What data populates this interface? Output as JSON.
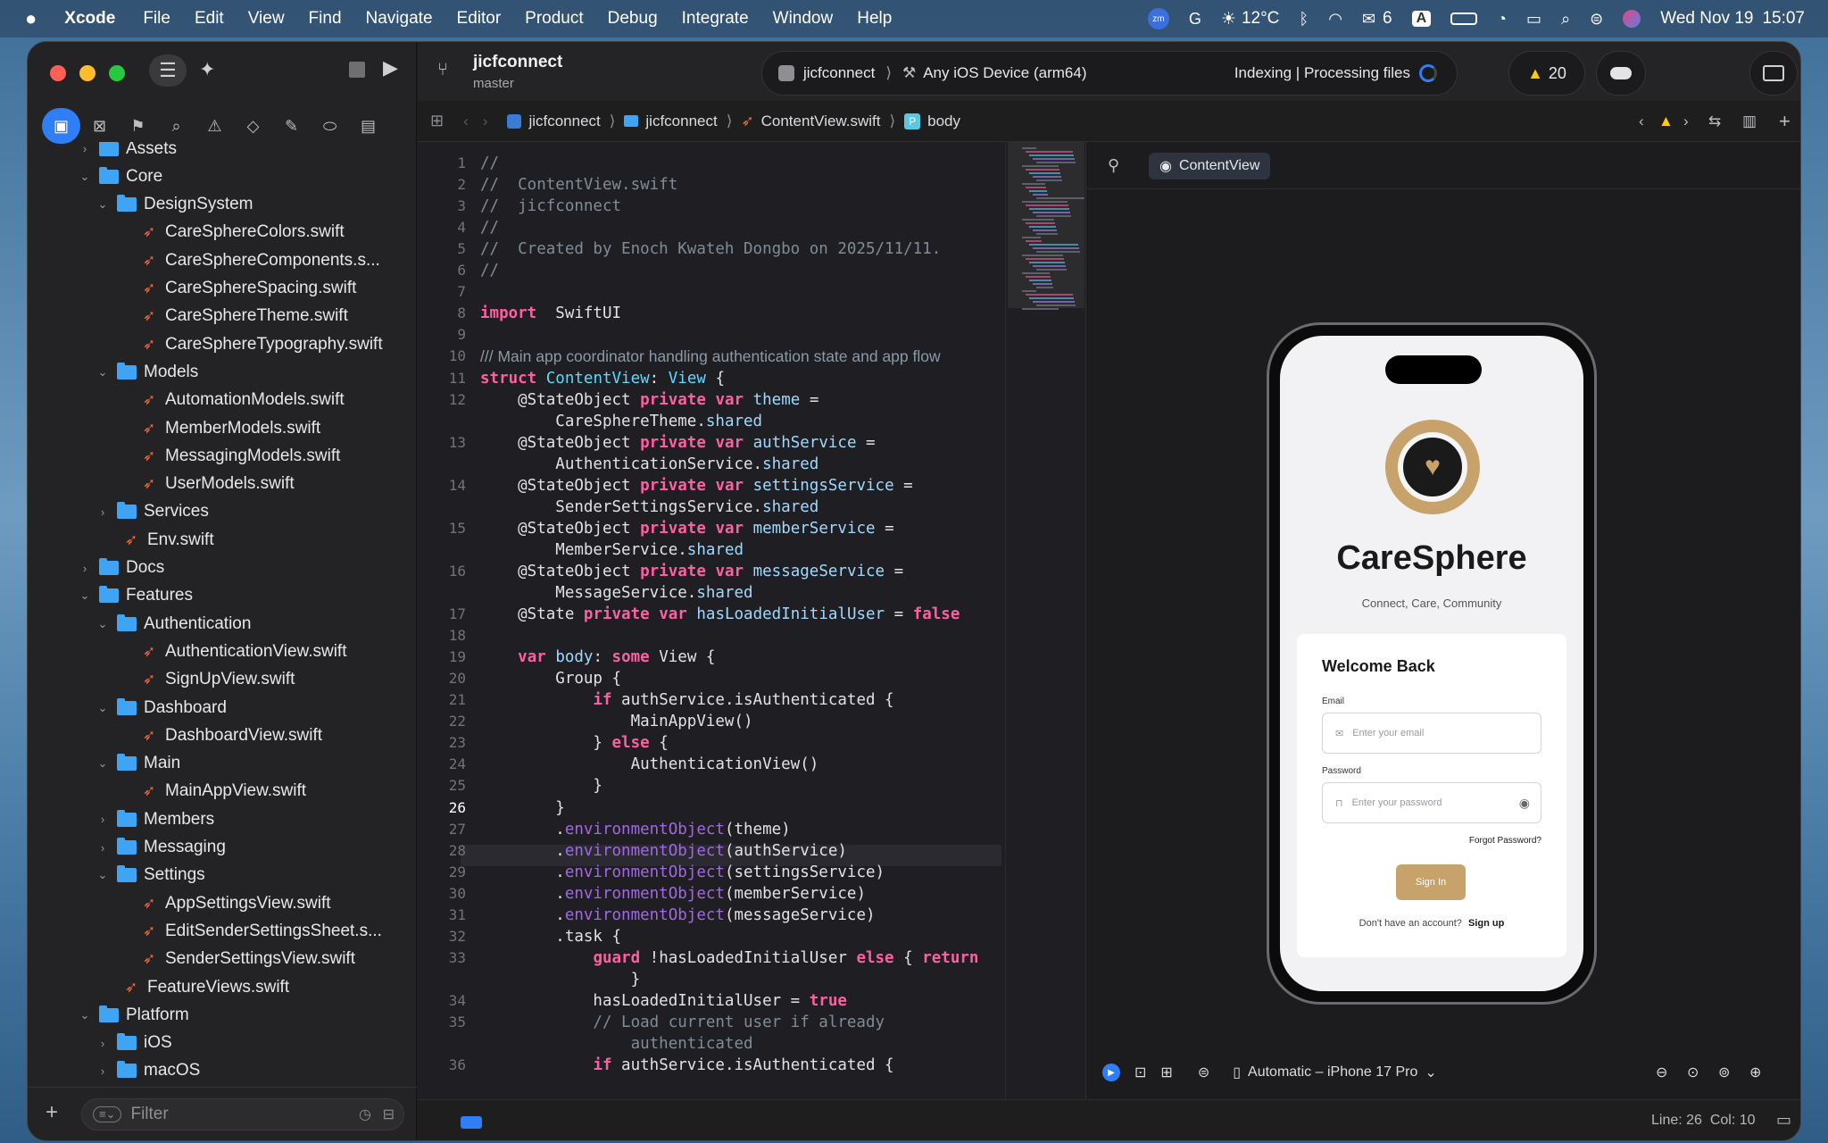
{
  "menubar": {
    "app": "Xcode",
    "items": [
      "File",
      "Edit",
      "View",
      "Find",
      "Navigate",
      "Editor",
      "Product",
      "Debug",
      "Integrate",
      "Window",
      "Help"
    ],
    "status": {
      "weather": "12°C",
      "wechat_count": "6",
      "input": "A",
      "date": "Wed Nov 19",
      "time": "15:07"
    }
  },
  "project": {
    "name": "jicfconnect",
    "branch": "master"
  },
  "scheme": {
    "target": "jicfconnect",
    "device": "Any iOS Device (arm64)",
    "status": "Indexing | Processing files",
    "warnings": "20"
  },
  "jumpbar": {
    "crumbs": [
      "jicfconnect",
      "jicfconnect",
      "ContentView.swift",
      "body"
    ]
  },
  "tree": [
    {
      "depth": 1,
      "kind": "folder",
      "open": false,
      "label": "Assets"
    },
    {
      "depth": 1,
      "kind": "folder",
      "open": true,
      "label": "Core"
    },
    {
      "depth": 2,
      "kind": "folder",
      "open": true,
      "label": "DesignSystem"
    },
    {
      "depth": 3,
      "kind": "swift",
      "label": "CareSphereColors.swift"
    },
    {
      "depth": 3,
      "kind": "swift",
      "label": "CareSphereComponents.s..."
    },
    {
      "depth": 3,
      "kind": "swift",
      "label": "CareSphereSpacing.swift"
    },
    {
      "depth": 3,
      "kind": "swift",
      "label": "CareSphereTheme.swift"
    },
    {
      "depth": 3,
      "kind": "swift",
      "label": "CareSphereTypography.swift"
    },
    {
      "depth": 2,
      "kind": "folder",
      "open": true,
      "label": "Models"
    },
    {
      "depth": 3,
      "kind": "swift",
      "label": "AutomationModels.swift"
    },
    {
      "depth": 3,
      "kind": "swift",
      "label": "MemberModels.swift"
    },
    {
      "depth": 3,
      "kind": "swift",
      "label": "MessagingModels.swift"
    },
    {
      "depth": 3,
      "kind": "swift",
      "label": "UserModels.swift"
    },
    {
      "depth": 2,
      "kind": "folder",
      "open": false,
      "label": "Services"
    },
    {
      "depth": 2,
      "kind": "swift",
      "label": "Env.swift"
    },
    {
      "depth": 1,
      "kind": "folder",
      "open": false,
      "label": "Docs"
    },
    {
      "depth": 1,
      "kind": "folder",
      "open": true,
      "label": "Features"
    },
    {
      "depth": 2,
      "kind": "folder",
      "open": true,
      "label": "Authentication"
    },
    {
      "depth": 3,
      "kind": "swift",
      "label": "AuthenticationView.swift"
    },
    {
      "depth": 3,
      "kind": "swift",
      "label": "SignUpView.swift"
    },
    {
      "depth": 2,
      "kind": "folder",
      "open": true,
      "label": "Dashboard"
    },
    {
      "depth": 3,
      "kind": "swift",
      "label": "DashboardView.swift"
    },
    {
      "depth": 2,
      "kind": "folder",
      "open": true,
      "label": "Main"
    },
    {
      "depth": 3,
      "kind": "swift",
      "label": "MainAppView.swift"
    },
    {
      "depth": 2,
      "kind": "folder",
      "open": false,
      "label": "Members"
    },
    {
      "depth": 2,
      "kind": "folder",
      "open": false,
      "label": "Messaging"
    },
    {
      "depth": 2,
      "kind": "folder",
      "open": true,
      "label": "Settings"
    },
    {
      "depth": 3,
      "kind": "swift",
      "label": "AppSettingsView.swift"
    },
    {
      "depth": 3,
      "kind": "swift",
      "label": "EditSenderSettingsSheet.s..."
    },
    {
      "depth": 3,
      "kind": "swift",
      "label": "SenderSettingsView.swift"
    },
    {
      "depth": 2,
      "kind": "swift",
      "label": "FeatureViews.swift"
    },
    {
      "depth": 1,
      "kind": "folder",
      "open": true,
      "label": "Platform"
    },
    {
      "depth": 2,
      "kind": "folder",
      "open": false,
      "label": "iOS"
    },
    {
      "depth": 2,
      "kind": "folder",
      "open": false,
      "label": "macOS"
    }
  ],
  "filter": {
    "placeholder": "Filter"
  },
  "code": [
    {
      "n": "1",
      "t": [
        [
          "cm",
          "//"
        ]
      ]
    },
    {
      "n": "2",
      "t": [
        [
          "cm",
          "//  ContentView.swift"
        ]
      ]
    },
    {
      "n": "3",
      "t": [
        [
          "cm",
          "//  jicfconnect"
        ]
      ]
    },
    {
      "n": "4",
      "t": [
        [
          "cm",
          "//"
        ]
      ]
    },
    {
      "n": "5",
      "t": [
        [
          "cm",
          "//  Created by Enoch Kwateh Dongbo on 2025/11/11."
        ]
      ]
    },
    {
      "n": "6",
      "t": [
        [
          "cm",
          "//"
        ]
      ]
    },
    {
      "n": "7",
      "t": []
    },
    {
      "n": "8",
      "t": [
        [
          "kw",
          "import"
        ],
        [
          "",
          "  SwiftUI"
        ]
      ]
    },
    {
      "n": "9",
      "t": []
    },
    {
      "n": "10",
      "t": [
        [
          "doc",
          "/// Main app coordinator handling authentication state and app flow"
        ]
      ]
    },
    {
      "n": "11",
      "t": [
        [
          "kw",
          "struct"
        ],
        [
          "",
          " "
        ],
        [
          "ty",
          "ContentView"
        ],
        [
          "",
          ": "
        ],
        [
          "ty",
          "View"
        ],
        [
          "",
          " {"
        ]
      ]
    },
    {
      "n": "12",
      "t": [
        [
          "",
          "    @StateObject "
        ],
        [
          "kw",
          "private"
        ],
        [
          "",
          " "
        ],
        [
          "kw",
          "var"
        ],
        [
          "",
          " "
        ],
        [
          "pr",
          "theme"
        ],
        [
          "",
          " ="
        ]
      ]
    },
    {
      "n": "",
      "t": [
        [
          "",
          "        CareSphereTheme."
        ],
        [
          "pr",
          "shared"
        ]
      ]
    },
    {
      "n": "13",
      "t": [
        [
          "",
          "    @StateObject "
        ],
        [
          "kw",
          "private"
        ],
        [
          "",
          " "
        ],
        [
          "kw",
          "var"
        ],
        [
          "",
          " "
        ],
        [
          "pr",
          "authService"
        ],
        [
          "",
          " ="
        ]
      ]
    },
    {
      "n": "",
      "t": [
        [
          "",
          "        AuthenticationService."
        ],
        [
          "pr",
          "shared"
        ]
      ]
    },
    {
      "n": "14",
      "t": [
        [
          "",
          "    @StateObject "
        ],
        [
          "kw",
          "private"
        ],
        [
          "",
          " "
        ],
        [
          "kw",
          "var"
        ],
        [
          "",
          " "
        ],
        [
          "pr",
          "settingsService"
        ],
        [
          "",
          " ="
        ]
      ]
    },
    {
      "n": "",
      "t": [
        [
          "",
          "        SenderSettingsService."
        ],
        [
          "pr",
          "shared"
        ]
      ]
    },
    {
      "n": "15",
      "t": [
        [
          "",
          "    @StateObject "
        ],
        [
          "kw",
          "private"
        ],
        [
          "",
          " "
        ],
        [
          "kw",
          "var"
        ],
        [
          "",
          " "
        ],
        [
          "pr",
          "memberService"
        ],
        [
          "",
          " ="
        ]
      ]
    },
    {
      "n": "",
      "t": [
        [
          "",
          "        MemberService."
        ],
        [
          "pr",
          "shared"
        ]
      ]
    },
    {
      "n": "16",
      "t": [
        [
          "",
          "    @StateObject "
        ],
        [
          "kw",
          "private"
        ],
        [
          "",
          " "
        ],
        [
          "kw",
          "var"
        ],
        [
          "",
          " "
        ],
        [
          "pr",
          "messageService"
        ],
        [
          "",
          " ="
        ]
      ]
    },
    {
      "n": "",
      "t": [
        [
          "",
          "        MessageService."
        ],
        [
          "pr",
          "shared"
        ]
      ]
    },
    {
      "n": "17",
      "t": [
        [
          "",
          "    @State "
        ],
        [
          "kw",
          "private"
        ],
        [
          "",
          " "
        ],
        [
          "kw",
          "var"
        ],
        [
          "",
          " "
        ],
        [
          "pr",
          "hasLoadedInitialUser"
        ],
        [
          "",
          " = "
        ],
        [
          "kw",
          "false"
        ]
      ]
    },
    {
      "n": "18",
      "t": []
    },
    {
      "n": "19",
      "t": [
        [
          "",
          "    "
        ],
        [
          "kw",
          "var"
        ],
        [
          "",
          " "
        ],
        [
          "pr",
          "body"
        ],
        [
          "",
          ": "
        ],
        [
          "kw",
          "some"
        ],
        [
          "",
          " View {"
        ]
      ]
    },
    {
      "n": "20",
      "t": [
        [
          "",
          "        Group {"
        ]
      ]
    },
    {
      "n": "21",
      "t": [
        [
          "",
          "            "
        ],
        [
          "kw",
          "if"
        ],
        [
          "",
          " authService.isAuthenticated {"
        ]
      ]
    },
    {
      "n": "22",
      "t": [
        [
          "",
          "                MainAppView()"
        ]
      ]
    },
    {
      "n": "23",
      "t": [
        [
          "",
          "            } "
        ],
        [
          "kw",
          "else"
        ],
        [
          "",
          " {"
        ]
      ]
    },
    {
      "n": "24",
      "t": [
        [
          "",
          "                AuthenticationView()"
        ]
      ]
    },
    {
      "n": "25",
      "t": [
        [
          "",
          "            }"
        ]
      ]
    },
    {
      "n": "26",
      "t": [
        [
          "",
          "        }"
        ]
      ]
    },
    {
      "n": "27",
      "t": [
        [
          "",
          "        ."
        ],
        [
          "fn",
          "environmentObject"
        ],
        [
          "",
          "(theme)"
        ]
      ]
    },
    {
      "n": "28",
      "t": [
        [
          "",
          "        ."
        ],
        [
          "fn",
          "environmentObject"
        ],
        [
          "",
          "(authService)"
        ]
      ]
    },
    {
      "n": "29",
      "t": [
        [
          "",
          "        ."
        ],
        [
          "fn",
          "environmentObject"
        ],
        [
          "",
          "(settingsService)"
        ]
      ]
    },
    {
      "n": "30",
      "t": [
        [
          "",
          "        ."
        ],
        [
          "fn",
          "environmentObject"
        ],
        [
          "",
          "(memberService)"
        ]
      ]
    },
    {
      "n": "31",
      "t": [
        [
          "",
          "        ."
        ],
        [
          "fn",
          "environmentObject"
        ],
        [
          "",
          "(messageService)"
        ]
      ]
    },
    {
      "n": "32",
      "t": [
        [
          "",
          "        .task {"
        ]
      ]
    },
    {
      "n": "33",
      "t": [
        [
          "",
          "            "
        ],
        [
          "kw",
          "guard"
        ],
        [
          "",
          " !hasLoadedInitialUser "
        ],
        [
          "kw",
          "else"
        ],
        [
          "",
          " { "
        ],
        [
          "kw",
          "return"
        ]
      ]
    },
    {
      "n": "",
      "t": [
        [
          "",
          "                }"
        ]
      ]
    },
    {
      "n": "34",
      "t": [
        [
          "",
          "            hasLoadedInitialUser = "
        ],
        [
          "kw",
          "true"
        ]
      ]
    },
    {
      "n": "35",
      "t": [
        [
          "cm",
          "            // Load current user if already"
        ]
      ]
    },
    {
      "n": "",
      "t": [
        [
          "cm",
          "                authenticated"
        ]
      ]
    },
    {
      "n": "36",
      "t": [
        [
          "",
          "            "
        ],
        [
          "kw",
          "if"
        ],
        [
          "",
          " authService.isAuthenticated {"
        ]
      ]
    }
  ],
  "current_line": "26",
  "preview": {
    "tab": "ContentView",
    "app_title": "CareSphere",
    "tagline": "Connect, Care, Community",
    "card_title": "Welcome Back",
    "email_label": "Email",
    "email_placeholder": "Enter your email",
    "password_label": "Password",
    "password_placeholder": "Enter your password",
    "forgot": "Forgot Password?",
    "signin": "Sign In",
    "no_account": "Don't have an account?",
    "signup": "Sign up",
    "device": "Automatic – iPhone 17 Pro"
  },
  "status": {
    "position": "Line: 26  Col: 10"
  },
  "colors": {
    "accent": "#2f7ef5",
    "gold": "#c7a36b",
    "swift": "#f06b3a",
    "folder": "#3ea4f3"
  }
}
